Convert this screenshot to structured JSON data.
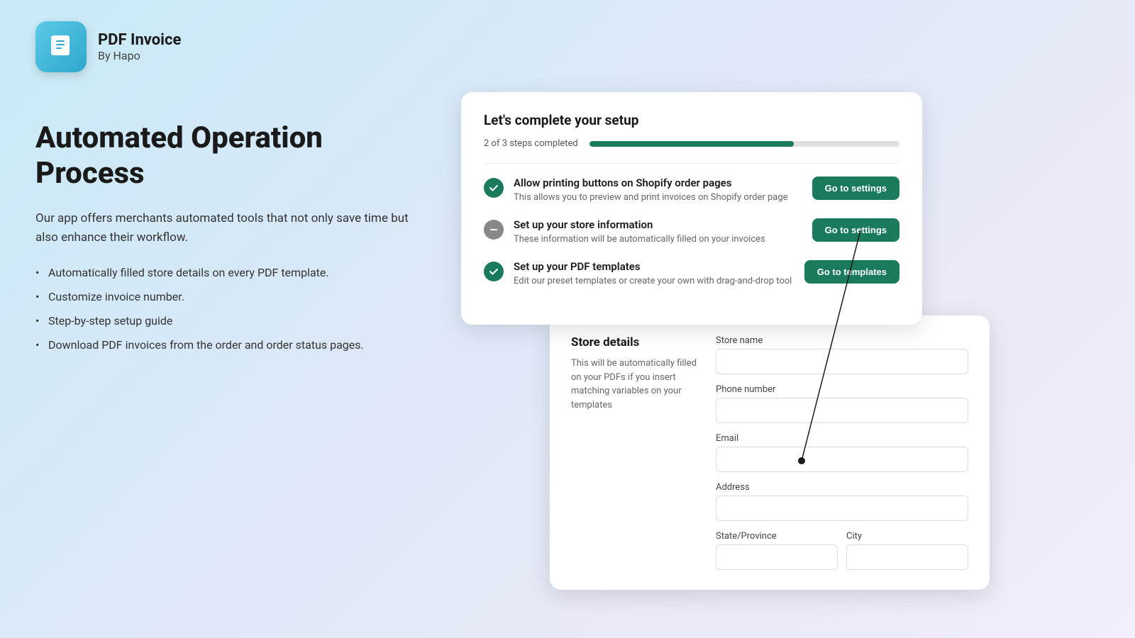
{
  "app": {
    "title": "PDF Invoice",
    "subtitle": "By Hapo"
  },
  "hero": {
    "title": "Automated Operation Process",
    "description": "Our app offers merchants automated tools that not only save time but also enhance their workflow.",
    "features": [
      "Automatically filled store details on every PDF template.",
      "Customize invoice number.",
      "Step-by-step setup guide",
      "Download PDF invoices from the order and order status pages."
    ]
  },
  "setup": {
    "title": "Let's complete your setup",
    "progress_label": "2 of 3 steps completed",
    "steps": [
      {
        "title": "Allow printing buttons on Shopify order pages",
        "desc": "This allows you to preview and print invoices on Shopify order page",
        "status": "completed",
        "button_label": "Go to settings"
      },
      {
        "title": "Set up your store information",
        "desc": "These information will be automatically filled on your invoices",
        "status": "in-progress",
        "button_label": "Go to settings"
      },
      {
        "title": "Set up your PDF templates",
        "desc": "Edit our preset templates or create your own with drag-and-drop tool",
        "status": "completed",
        "button_label": "Go to templates"
      }
    ]
  },
  "store_details": {
    "title": "Store details",
    "description": "This will be automatically filled on your PDFs if you insert matching variables on your templates",
    "fields": [
      {
        "label": "Store name",
        "placeholder": ""
      },
      {
        "label": "Phone number",
        "placeholder": ""
      },
      {
        "label": "Email",
        "placeholder": ""
      },
      {
        "label": "Address",
        "placeholder": ""
      },
      {
        "label": "State/Province",
        "placeholder": ""
      },
      {
        "label": "City",
        "placeholder": ""
      }
    ]
  }
}
